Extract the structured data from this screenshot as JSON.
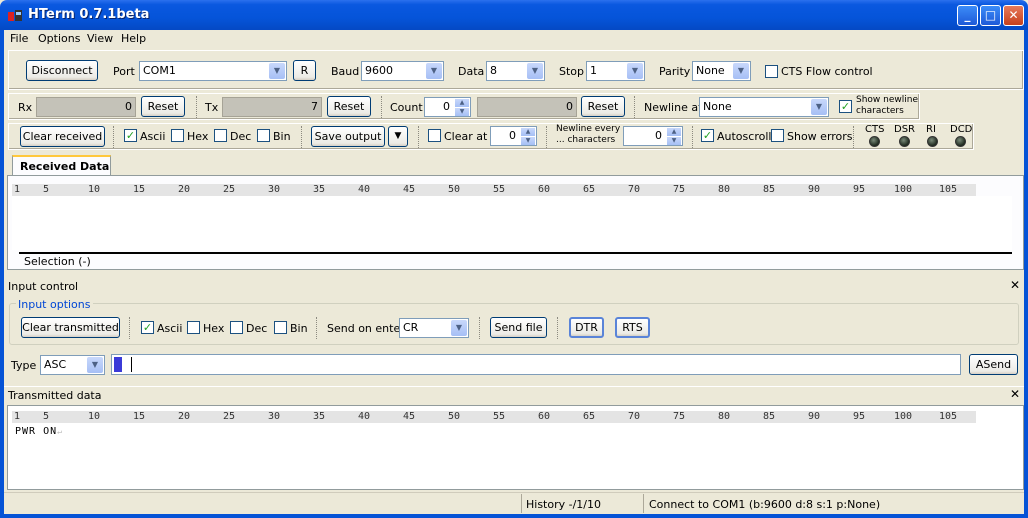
{
  "window": {
    "title": "HTerm 0.7.1beta",
    "minimize": "_",
    "maximize": "□",
    "close": "✕"
  },
  "menu": [
    "File",
    "Options",
    "View",
    "Help"
  ],
  "connection": {
    "disconnect_label": "Disconnect",
    "port_label": "Port",
    "port_value": "COM1",
    "refresh_label": "R",
    "baud_label": "Baud",
    "baud_value": "9600",
    "data_label": "Data",
    "data_value": "8",
    "stop_label": "Stop",
    "stop_value": "1",
    "parity_label": "Parity",
    "parity_value": "None",
    "cts_flow_label": "CTS Flow control",
    "cts_flow_checked": false
  },
  "counters": {
    "rx_label": "Rx",
    "rx_value": "0",
    "rx_reset": "Reset",
    "tx_label": "Tx",
    "tx_value": "7",
    "tx_reset": "Reset",
    "count_label": "Count",
    "count_value": "0",
    "count_result": "0",
    "count_reset": "Reset",
    "newline_at_label": "Newline at",
    "newline_at_value": "None",
    "show_newline_label_1": "Show newline",
    "show_newline_label_2": "characters",
    "show_newline_checked": true
  },
  "receive_toolbar": {
    "clear_received": "Clear received",
    "ascii": "Ascii",
    "ascii_checked": true,
    "hex": "Hex",
    "dec": "Dec",
    "bin": "Bin",
    "save_output": "Save output",
    "clear_at_label": "Clear at",
    "clear_at_value": "0",
    "newline_every_1": "Newline every",
    "newline_every_2": "... characters",
    "newline_every_value": "0",
    "autoscroll": "Autoscroll",
    "autoscroll_checked": true,
    "show_errors": "Show errors",
    "leds": [
      "CTS",
      "DSR",
      "RI",
      "DCD"
    ]
  },
  "received": {
    "tab_label": "Received Data",
    "ruler": [
      "1",
      "5",
      "10",
      "15",
      "20",
      "25",
      "30",
      "35",
      "40",
      "45",
      "50",
      "55",
      "60",
      "65",
      "70",
      "75",
      "80",
      "85",
      "90",
      "95",
      "100",
      "105"
    ],
    "selection": "Selection (-)"
  },
  "input_control": {
    "title": "Input control",
    "close": "✕",
    "options_label": "Input options",
    "clear_transmitted": "Clear transmitted",
    "ascii": "Ascii",
    "ascii_checked": true,
    "hex": "Hex",
    "dec": "Dec",
    "bin": "Bin",
    "send_on_enter_label": "Send on enter",
    "send_on_enter_value": "CR",
    "send_file": "Send file",
    "dtr": "DTR",
    "rts": "RTS",
    "type_label": "Type",
    "type_value": "ASC",
    "asend": "ASend"
  },
  "transmitted": {
    "title": "Transmitted data",
    "close": "✕",
    "ruler": [
      "1",
      "5",
      "10",
      "15",
      "20",
      "25",
      "30",
      "35",
      "40",
      "45",
      "50",
      "55",
      "60",
      "65",
      "70",
      "75",
      "80",
      "85",
      "90",
      "95",
      "100",
      "105"
    ],
    "content": "PWR ON",
    "content_suffix": "↵"
  },
  "status": {
    "history": "History -/1/10",
    "connection": "Connect to COM1 (b:9600 d:8 s:1 p:None)"
  }
}
